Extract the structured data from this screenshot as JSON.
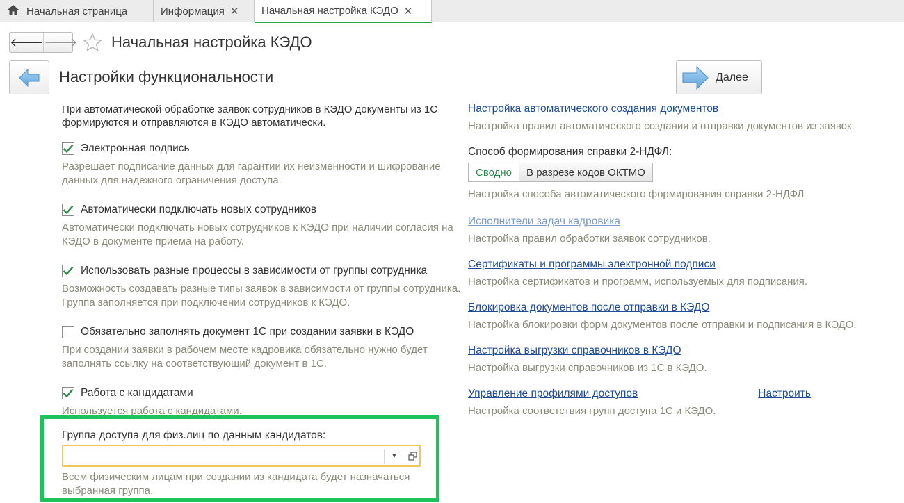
{
  "tabs": [
    {
      "label": "Начальная страница",
      "closable": false,
      "active": false
    },
    {
      "label": "Информация",
      "closable": true,
      "active": false
    },
    {
      "label": "Начальная настройка КЭДО",
      "closable": true,
      "active": true
    }
  ],
  "header": {
    "title": "Начальная настройка КЭДО"
  },
  "section": {
    "title": "Настройки функциональности",
    "next_label": "Далее"
  },
  "left": {
    "intro": "При автоматической обработке заявок сотрудников в КЭДО документы из 1С формируются и отправляются в КЭДО автоматически.",
    "options": [
      {
        "label": "Электронная подпись",
        "checked": true,
        "desc": "Разрешает подписание данных для гарантии их неизменности и шифрование данных для надежного ограничения доступа."
      },
      {
        "label": "Автоматически подключать новых сотрудников",
        "checked": true,
        "desc": "Автоматически подключать новых сотрудников к КЭДО при наличии согласия на КЭДО в документе приема на работу."
      },
      {
        "label": "Использовать разные процессы в зависимости от группы сотрудника",
        "checked": true,
        "desc": "Возможность создавать разные типы заявок в зависимости от группы сотрудника. Группа заполняется при подключении сотрудников к КЭДО."
      },
      {
        "label": "Обязательно заполнять документ 1С при создании заявки в КЭДО",
        "checked": false,
        "desc": "При создании заявки в рабочем месте кадровика обязательно нужно будет заполнять ссылку на соответствующий документ в 1С."
      },
      {
        "label": "Работа с кандидатами",
        "checked": true,
        "desc": "Используется работа с кандидатами."
      }
    ],
    "access_group": {
      "label": "Группа доступа для физ.лиц по данным кандидатов:",
      "value": "",
      "desc": "Всем физическим лицам при создании из кандидата будет назначаться выбранная группа."
    }
  },
  "right": {
    "auto_docs": {
      "link": "Настройка автоматического создания документов",
      "desc": "Настройка правил автоматического создания и отправки документов из заявок."
    },
    "ndfl": {
      "label": "Способ формирования справки 2-НДФЛ:",
      "options": [
        "Сводно",
        "В разрезе кодов ОКТМО"
      ],
      "selected": "Сводно",
      "desc": "Настройка способа автоматического формирования справки 2-НДФЛ"
    },
    "executors": {
      "link": "Исполнители задач кадровика",
      "desc": "Настройка правил обработки заявок сотрудников."
    },
    "certs": {
      "link": "Сертификаты и программы электронной подписи",
      "desc": "Настройка сертификатов и программ, используемых для подписания."
    },
    "blocking": {
      "link": "Блокировка документов после отправки в КЭДО",
      "desc": "Настройка блокировки форм документов после отправки и подписания в КЭДО."
    },
    "export": {
      "link": "Настройка выгрузки справочников в КЭДО",
      "desc": "Настройка выгрузки справочников из 1С в КЭДО."
    },
    "profiles": {
      "link": "Управление профилями доступов",
      "action": "Настроить",
      "desc": "Настройка соответствия групп доступа 1С и КЭДО."
    }
  }
}
